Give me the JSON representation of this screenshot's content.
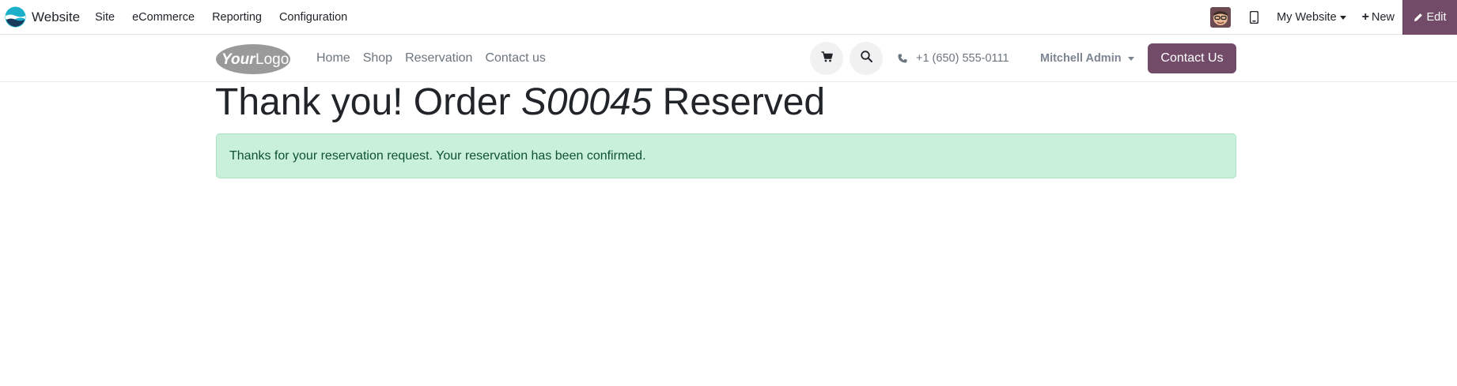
{
  "topbar": {
    "app_name": "Website",
    "menu": [
      {
        "label": "Site"
      },
      {
        "label": "eCommerce"
      },
      {
        "label": "Reporting"
      },
      {
        "label": "Configuration"
      }
    ],
    "website_selector": "My Website",
    "new_label": "New",
    "edit_label": "Edit",
    "icons": {
      "app": "website-app-icon",
      "mobile": "mobile-preview-icon",
      "new": "plus-icon",
      "edit": "pencil-icon"
    }
  },
  "site_header": {
    "logo_text": "YourLogo",
    "nav": [
      {
        "label": "Home"
      },
      {
        "label": "Shop"
      },
      {
        "label": "Reservation"
      },
      {
        "label": "Contact us"
      }
    ],
    "phone": "+1 (650) 555-0111",
    "user": "Mitchell Admin",
    "contact_button": "Contact Us",
    "icons": {
      "cart": "shopping-cart-icon",
      "search": "search-icon",
      "phone": "phone-icon"
    }
  },
  "main": {
    "title_prefix": "Thank you! Order ",
    "order_ref": "S00045",
    "title_suffix": " Reserved",
    "alert": "Thanks for your reservation request. Your reservation has been confirmed."
  },
  "colors": {
    "brand": "#714b67",
    "alert_bg": "#c9f0db",
    "alert_text": "#0f5132"
  }
}
